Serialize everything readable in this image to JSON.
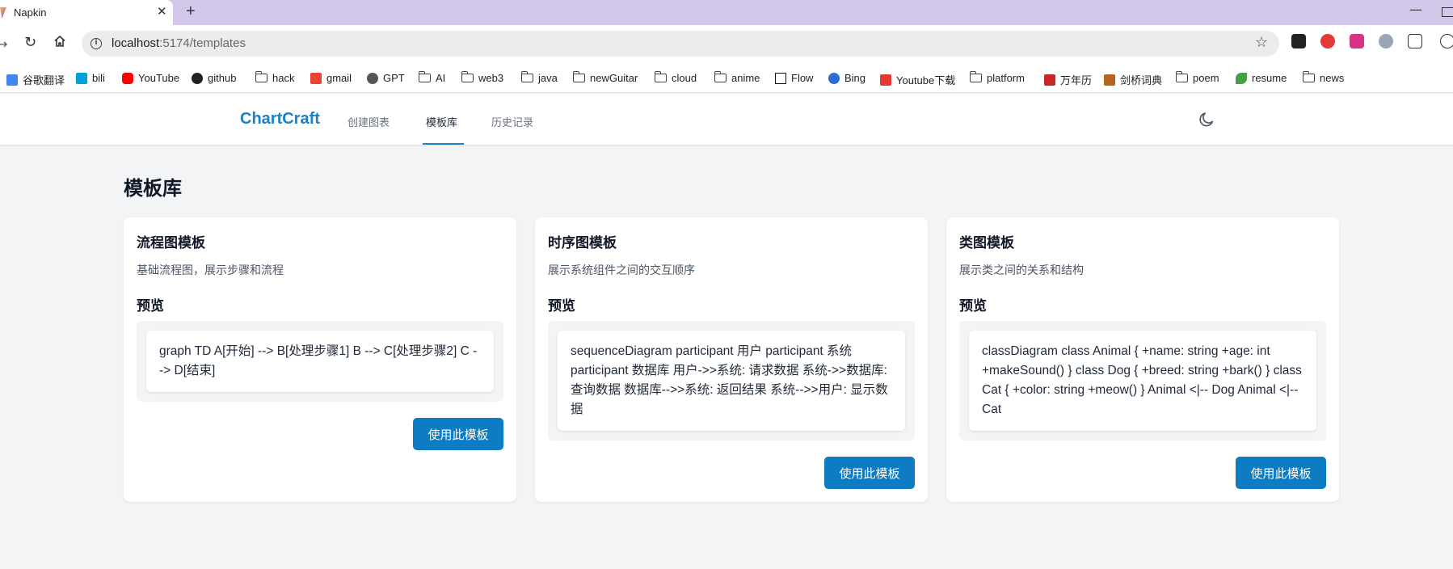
{
  "browser": {
    "tab_title": "Napkin",
    "tab_close": "✕",
    "new_tab": "+",
    "url_host": "localhost",
    "url_path": ":5174/templates",
    "bookmarks": [
      {
        "label": "谷歌翻译",
        "icon": "translate-icon",
        "color": "#4285f4"
      },
      {
        "label": "bili",
        "icon": "bilibili-icon",
        "color": "#00a1d6"
      },
      {
        "label": "YouTube",
        "icon": "youtube-icon",
        "color": "#ff0000"
      },
      {
        "label": "github",
        "icon": "github-icon",
        "color": "#222222"
      },
      {
        "label": "hack",
        "icon": "folder-icon"
      },
      {
        "label": "gmail",
        "icon": "gmail-icon",
        "color": "#ea4335"
      },
      {
        "label": "GPT",
        "icon": "openai-icon",
        "color": "#333333"
      },
      {
        "label": "AI",
        "icon": "folder-icon"
      },
      {
        "label": "web3",
        "icon": "folder-icon"
      },
      {
        "label": "java",
        "icon": "folder-icon"
      },
      {
        "label": "newGuitar",
        "icon": "folder-icon"
      },
      {
        "label": "cloud",
        "icon": "folder-icon"
      },
      {
        "label": "anime",
        "icon": "folder-icon"
      },
      {
        "label": "Flow",
        "icon": "flow-icon",
        "color": "#111111"
      },
      {
        "label": "Bing",
        "icon": "bing-search-icon",
        "color": "#2b6cd6"
      },
      {
        "label": "Youtube下载",
        "icon": "download-icon",
        "color": "#e53935"
      },
      {
        "label": "platform",
        "icon": "folder-icon"
      },
      {
        "label": "万年历",
        "icon": "calendar-icon",
        "color": "#c62828"
      },
      {
        "label": "剑桥词典",
        "icon": "cambridge-icon",
        "color": "#b5651d"
      },
      {
        "label": "poem",
        "icon": "folder-icon"
      },
      {
        "label": "resume",
        "icon": "leaf-icon",
        "color": "#43a047"
      },
      {
        "label": "news",
        "icon": "folder-icon"
      }
    ]
  },
  "app": {
    "logo": "ChartCraft",
    "nav": [
      {
        "label": "创建图表"
      },
      {
        "label": "模板库"
      },
      {
        "label": "历史记录"
      }
    ],
    "accent_color": "#1b80c4"
  },
  "page": {
    "title": "模板库",
    "preview_label": "预览",
    "use_button_label": "使用此模板",
    "templates": [
      {
        "title": "流程图模板",
        "description": "基础流程图，展示步骤和流程",
        "code": "graph TD A[开始] --> B[处理步骤1] B --> C[处理步骤2] C --> D[结束]"
      },
      {
        "title": "时序图模板",
        "description": "展示系统组件之间的交互顺序",
        "code": "sequenceDiagram participant 用户 participant 系统 participant 数据库 用户->>系统: 请求数据 系统->>数据库: 查询数据 数据库-->>系统: 返回结果 系统-->>用户: 显示数据"
      },
      {
        "title": "类图模板",
        "description": "展示类之间的关系和结构",
        "code": "classDiagram class Animal { +name: string +age: int +makeSound() } class Dog { +breed: string +bark() } class Cat { +color: string +meow() } Animal <|-- Dog Animal <|-- Cat"
      }
    ]
  }
}
